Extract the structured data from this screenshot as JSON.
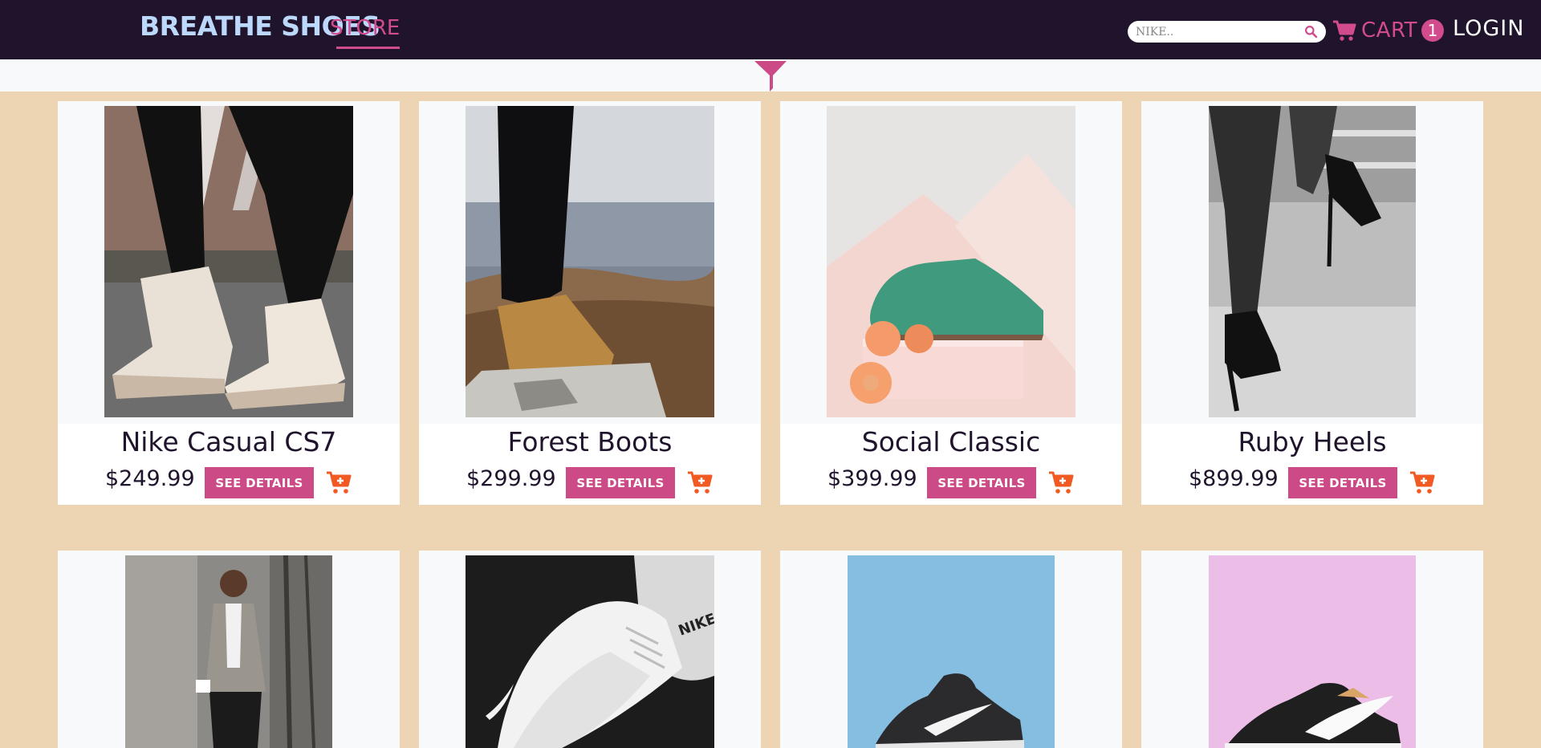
{
  "header": {
    "brand": "BREATHE SHOES",
    "nav_store": "STORE",
    "search_placeholder": "NIKE..",
    "cart_label": "CART",
    "cart_count": "1",
    "login_label": "LOGIN"
  },
  "colors": {
    "navbar_bg": "#20132c",
    "brand": "#bcd8fb",
    "accent": "#d24b8d",
    "page_bg": "#edd4b2",
    "card_bg": "#f7f9fb",
    "button_bg": "#cc4a86",
    "cart_add_icon": "#f15a22"
  },
  "icons": {
    "search": "search-icon",
    "cart": "shopping-cart-icon",
    "filter": "filter-funnel-icon",
    "add_to_cart": "cart-plus-icon"
  },
  "products": [
    {
      "name": "Nike Casual CS7",
      "price": "$249.99",
      "details_label": "SEE DETAILS",
      "image": "white high-top canvas sneakers on street"
    },
    {
      "name": "Forest Boots",
      "price": "$299.99",
      "details_label": "SEE DETAILS",
      "image": "tan leather boot on a rock above valley"
    },
    {
      "name": "Social Classic",
      "price": "$399.99",
      "details_label": "SEE DETAILS",
      "image": "green suede oxford shoe with peaches"
    },
    {
      "name": "Ruby Heels",
      "price": "$899.99",
      "details_label": "SEE DETAILS",
      "image": "black strappy high heels, black and white"
    },
    {
      "image": "woman in blazer walking on street"
    },
    {
      "image": "white sneaker on black nike fabric"
    },
    {
      "image": "black basketball shoe on blue background"
    },
    {
      "image": "black sneaker on pink background"
    }
  ]
}
